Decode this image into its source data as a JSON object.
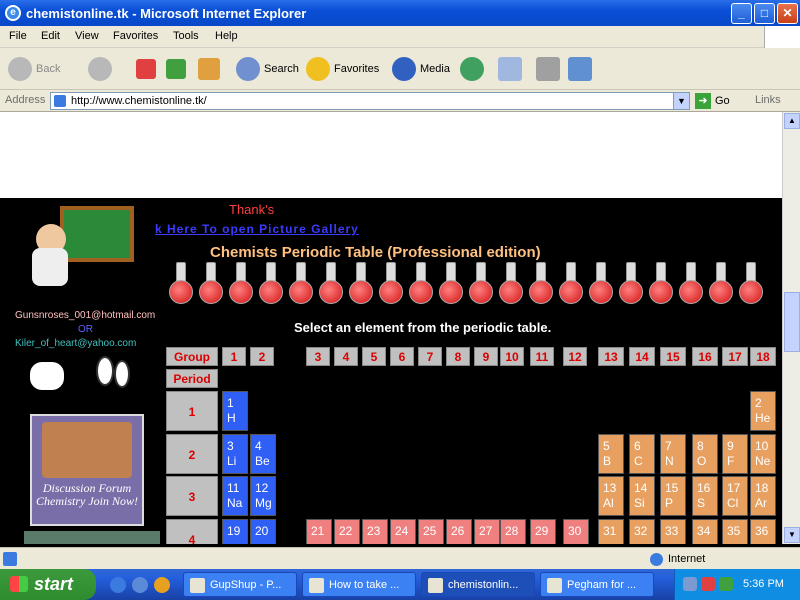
{
  "window": {
    "title": "chemistonline.tk - Microsoft Internet Explorer",
    "minimize": "_",
    "maximize": "□",
    "close": "✕"
  },
  "menu": [
    "File",
    "Edit",
    "View",
    "Favorites",
    "Tools",
    "Help"
  ],
  "toolbar": {
    "back": "Back",
    "search": "Search",
    "favorites": "Favorites",
    "media": "Media"
  },
  "address": {
    "label": "Address",
    "url": "http://www.chemistonline.tk/",
    "go": "Go",
    "links": "Links"
  },
  "page": {
    "thanks": "Thank's",
    "gallery_link": "k Here To open Picture Gallery",
    "periodic_title": "Chemists Periodic Table (Professional edition)",
    "select_msg": "Select an element from the periodic table.",
    "email1": "Gunsnroses_001@hotmail.com",
    "or": "OR",
    "email2": "Kiler_of_heart@yahoo.com",
    "forum_text": "Discussion Forum Chemistry Join Now!",
    "group_label": "Group",
    "period_label": "Period",
    "groups": [
      "1",
      "2",
      "3",
      "4",
      "5",
      "6",
      "7",
      "8",
      "9",
      "10",
      "11",
      "12",
      "13",
      "14",
      "15",
      "16",
      "17",
      "18"
    ],
    "periods": [
      "1",
      "2",
      "3",
      "4"
    ],
    "elements": {
      "H": {
        "num": "1",
        "sym": "H"
      },
      "He": {
        "num": "2",
        "sym": "He"
      },
      "Li": {
        "num": "3",
        "sym": "Li"
      },
      "Be": {
        "num": "4",
        "sym": "Be"
      },
      "B": {
        "num": "5",
        "sym": "B"
      },
      "C": {
        "num": "6",
        "sym": "C"
      },
      "N": {
        "num": "7",
        "sym": "N"
      },
      "O": {
        "num": "8",
        "sym": "O"
      },
      "F": {
        "num": "9",
        "sym": "F"
      },
      "Ne": {
        "num": "10",
        "sym": "Ne"
      },
      "Na": {
        "num": "11",
        "sym": "Na"
      },
      "Mg": {
        "num": "12",
        "sym": "Mg"
      },
      "Al": {
        "num": "13",
        "sym": "Al"
      },
      "Si": {
        "num": "14",
        "sym": "Si"
      },
      "P": {
        "num": "15",
        "sym": "P"
      },
      "S": {
        "num": "16",
        "sym": "S"
      },
      "Cl": {
        "num": "17",
        "sym": "Cl"
      },
      "Ar": {
        "num": "18",
        "sym": "Ar"
      },
      "K": {
        "num": "19",
        "sym": ""
      },
      "Ca": {
        "num": "20",
        "sym": ""
      },
      "Sc": {
        "num": "21",
        "sym": ""
      },
      "Ti": {
        "num": "22",
        "sym": ""
      },
      "V": {
        "num": "23",
        "sym": ""
      },
      "Cr": {
        "num": "24",
        "sym": ""
      },
      "Mn": {
        "num": "25",
        "sym": ""
      },
      "Fe": {
        "num": "26",
        "sym": ""
      },
      "Co": {
        "num": "27",
        "sym": ""
      },
      "Ni": {
        "num": "28",
        "sym": ""
      },
      "Cu": {
        "num": "29",
        "sym": ""
      },
      "Zn": {
        "num": "30",
        "sym": ""
      },
      "Ga": {
        "num": "31",
        "sym": ""
      },
      "Ge": {
        "num": "32",
        "sym": ""
      },
      "As": {
        "num": "33",
        "sym": ""
      },
      "Se": {
        "num": "34",
        "sym": ""
      },
      "Br": {
        "num": "35",
        "sym": ""
      },
      "Kr": {
        "num": "36",
        "sym": ""
      }
    }
  },
  "status": {
    "zone": "Internet"
  },
  "taskbar": {
    "start": "start",
    "tasks": [
      "GupShup - P...",
      "How to take ...",
      "chemistonlin...",
      "Pegham for ..."
    ],
    "clock": "5:36 PM"
  }
}
